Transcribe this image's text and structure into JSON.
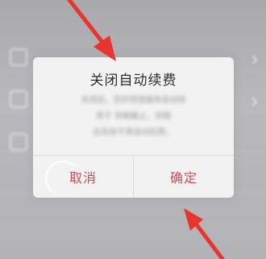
{
  "dialog": {
    "title": "关闭自动续费",
    "body_lines": [
      "关闭后，您的增值服务自动续",
      "将于  到期截止，到期",
      "后系统不再自动扣费。"
    ],
    "cancel_label": "取消",
    "confirm_label": "确定"
  },
  "colors": {
    "accent": "#c44e57",
    "arrow": "#e8352e",
    "dialog_bg": "#f2f2f2",
    "overlay": "#b5b5b9"
  },
  "icons": [
    "arrow-annotation-icon"
  ]
}
